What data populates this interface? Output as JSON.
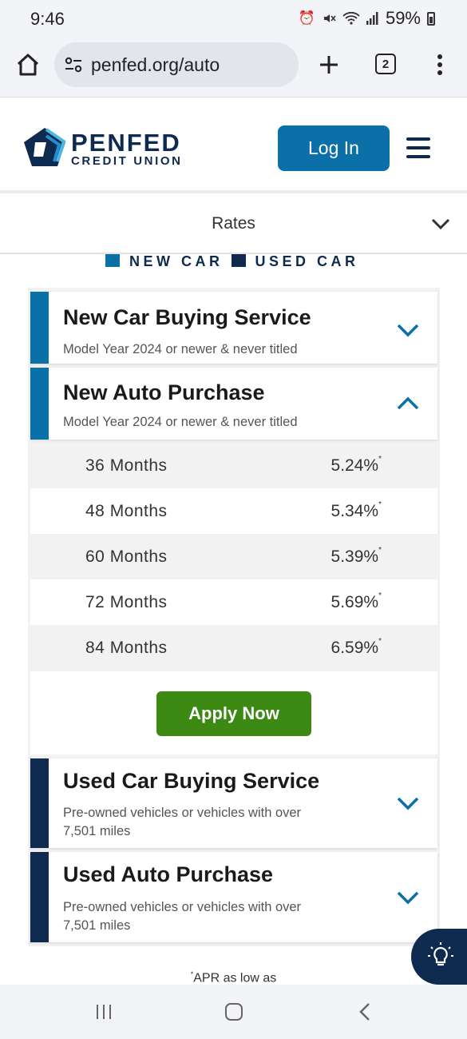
{
  "status_bar": {
    "time": "9:46",
    "battery": "59%",
    "icons": [
      "alarm-icon",
      "mute-icon",
      "wifi-icon",
      "signal-icon",
      "battery-icon"
    ]
  },
  "browser": {
    "url": "penfed.org/auto",
    "tab_count": "2"
  },
  "header": {
    "logo_name": "PENFED",
    "logo_sub": "CREDIT UNION",
    "login_label": "Log In"
  },
  "rates_dropdown": {
    "label": "Rates"
  },
  "legend": {
    "items": [
      {
        "label": "NEW CAR",
        "color": "#0b6fa8"
      },
      {
        "label": "USED CAR",
        "color": "#0e2a4e"
      }
    ]
  },
  "products": [
    {
      "title": "New Car Buying Service",
      "subtitle": "Model Year 2024 or newer & never titled",
      "expanded": false,
      "color": "#0b6fa8"
    },
    {
      "title": "New Auto Purchase",
      "subtitle": "Model Year 2024 or newer & never titled",
      "expanded": true,
      "color": "#0b6fa8"
    },
    {
      "title": "Used Car Buying Service",
      "subtitle_line1": "Pre-owned vehicles or vehicles with over",
      "subtitle_line2": "7,501 miles",
      "expanded": false,
      "color": "#0e2a4e"
    },
    {
      "title": "Used Auto Purchase",
      "subtitle_line1": "Pre-owned vehicles or vehicles with over",
      "subtitle_line2": "7,501 miles",
      "expanded": false,
      "color": "#0e2a4e"
    }
  ],
  "rates": [
    {
      "term": "36 Months",
      "rate": "5.24%",
      "mark": "*"
    },
    {
      "term": "48 Months",
      "rate": "5.34%",
      "mark": "*"
    },
    {
      "term": "60 Months",
      "rate": "5.39%",
      "mark": "*"
    },
    {
      "term": "72 Months",
      "rate": "5.69%",
      "mark": "*"
    },
    {
      "term": "84 Months",
      "rate": "6.59%",
      "mark": "*"
    }
  ],
  "apply_label": "Apply Now",
  "footnote": {
    "mark": "*",
    "text": "APR as low as"
  }
}
